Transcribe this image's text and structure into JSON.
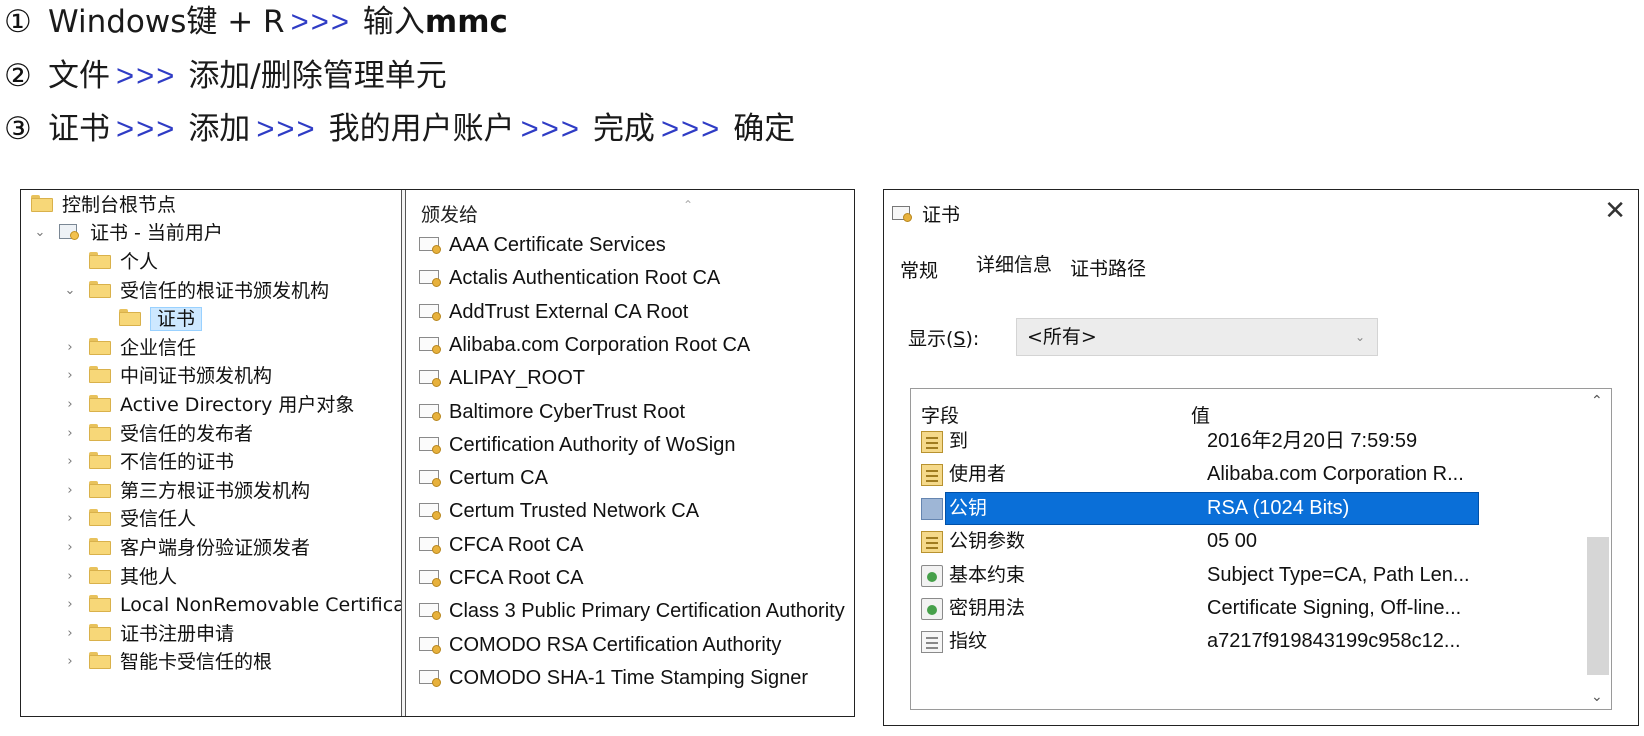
{
  "instructions": [
    {
      "num": "①",
      "parts": [
        {
          "t": "Windows键 + R",
          "k": "txt"
        },
        {
          "t": ">>>",
          "k": "arr"
        },
        {
          "t": "输入",
          "k": "txt"
        },
        {
          "t": "mmc",
          "k": "bold"
        }
      ]
    },
    {
      "num": "②",
      "parts": [
        {
          "t": "文件",
          "k": "txt"
        },
        {
          "t": ">>>",
          "k": "arr"
        },
        {
          "t": "添加/删除管理单元",
          "k": "txt"
        }
      ]
    },
    {
      "num": "③",
      "parts": [
        {
          "t": "证书",
          "k": "txt"
        },
        {
          "t": ">>>",
          "k": "arr"
        },
        {
          "t": "添加",
          "k": "txt"
        },
        {
          "t": ">>>",
          "k": "arr"
        },
        {
          "t": "我的用户账户",
          "k": "txt"
        },
        {
          "t": ">>>",
          "k": "arr"
        },
        {
          "t": "完成",
          "k": "txt"
        },
        {
          "t": ">>>",
          "k": "arr"
        },
        {
          "t": "确定",
          "k": "txt"
        }
      ]
    }
  ],
  "mmc": {
    "tree": {
      "root": "控制台根节点",
      "store": "证书 - 当前用户",
      "items": [
        {
          "label": "个人",
          "expanded": false,
          "has_children": false
        },
        {
          "label": "受信任的根证书颁发机构",
          "expanded": true,
          "has_children": true
        },
        {
          "label": "证书",
          "child": true,
          "selected": true
        },
        {
          "label": "企业信任",
          "has_children": true
        },
        {
          "label": "中间证书颁发机构",
          "has_children": true
        },
        {
          "label": "Active Directory 用户对象",
          "has_children": true
        },
        {
          "label": "受信任的发布者",
          "has_children": true
        },
        {
          "label": "不信任的证书",
          "has_children": true
        },
        {
          "label": "第三方根证书颁发机构",
          "has_children": true
        },
        {
          "label": "受信任人",
          "has_children": true
        },
        {
          "label": "客户端身份验证颁发者",
          "has_children": true
        },
        {
          "label": "其他人",
          "has_children": true
        },
        {
          "label": "Local NonRemovable Certificates",
          "has_children": true
        },
        {
          "label": "证书注册申请",
          "has_children": true
        },
        {
          "label": "智能卡受信任的根",
          "has_children": true
        }
      ]
    },
    "list": {
      "column_header": "颁发给",
      "items": [
        "AAA Certificate Services",
        "Actalis Authentication Root CA",
        "AddTrust External CA Root",
        "Alibaba.com Corporation Root CA",
        "ALIPAY_ROOT",
        "Baltimore CyberTrust Root",
        "Certification Authority of WoSign",
        "Certum CA",
        "Certum Trusted Network CA",
        "CFCA Root CA",
        "CFCA Root CA",
        "Class 3 Public Primary Certification Authority",
        "COMODO RSA Certification Authority",
        "COMODO SHA-1 Time Stamping Signer"
      ]
    }
  },
  "dialog": {
    "title": "证书",
    "close_glyph": "✕",
    "tabs": [
      "常规",
      "详细信息",
      "证书路径"
    ],
    "show_label": "显示(",
    "show_label_key": "S",
    "show_label_end": "):",
    "show_value": "<所有>",
    "fields_header": {
      "field": "字段",
      "value": "值"
    },
    "fields": [
      {
        "name": "到",
        "value": "2016年2月20日 7:59:59",
        "icon": "doc"
      },
      {
        "name": "使用者",
        "value": "Alibaba.com Corporation R...",
        "icon": "doc"
      },
      {
        "name": "公钥",
        "value": "RSA (1024 Bits)",
        "icon": "key",
        "selected": true
      },
      {
        "name": "公钥参数",
        "value": "05 00",
        "icon": "doc"
      },
      {
        "name": "基本约束",
        "value": "Subject Type=CA, Path Len...",
        "icon": "ext"
      },
      {
        "name": "密钥用法",
        "value": "Certificate Signing, Off-line...",
        "icon": "ext"
      },
      {
        "name": "指纹",
        "value": "a7217f919843199c958c12...",
        "icon": "plain"
      }
    ],
    "colors": {
      "selection": "#0a6fd8",
      "arrow": "#2f3cc5"
    }
  }
}
